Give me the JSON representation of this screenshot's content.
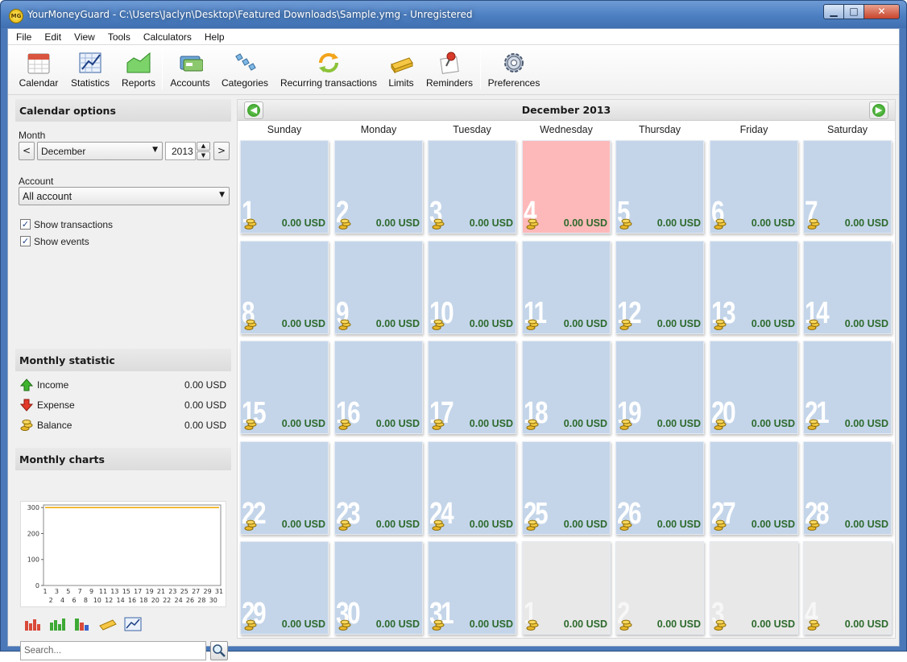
{
  "window": {
    "title": "YourMoneyGuard - C:\\Users\\Jaclyn\\Desktop\\Featured Downloads\\Sample.ymg - Unregistered",
    "app_icon_text": "MG"
  },
  "menu": [
    "File",
    "Edit",
    "View",
    "Tools",
    "Calculators",
    "Help"
  ],
  "toolbar": [
    {
      "label": "Calendar",
      "icon": "calendar-icon"
    },
    {
      "label": "Statistics",
      "icon": "statistics-icon"
    },
    {
      "label": "Reports",
      "icon": "reports-icon"
    },
    {
      "label": "Accounts",
      "icon": "accounts-icon"
    },
    {
      "label": "Categories",
      "icon": "categories-icon"
    },
    {
      "label": "Recurring transactions",
      "icon": "recurring-icon"
    },
    {
      "label": "Limits",
      "icon": "limits-icon"
    },
    {
      "label": "Reminders",
      "icon": "reminders-icon"
    },
    {
      "label": "Preferences",
      "icon": "gear-icon"
    }
  ],
  "calendar_options": {
    "title": "Calendar options",
    "month_label": "Month",
    "month_value": "December",
    "year_value": "2013",
    "prev_btn": "<",
    "next_btn": ">",
    "account_label": "Account",
    "account_value": "All account",
    "show_transactions": "Show transactions",
    "show_events": "Show events"
  },
  "monthly_statistic": {
    "title": "Monthly statistic",
    "rows": [
      {
        "label": "Income",
        "value": "0.00 USD"
      },
      {
        "label": "Expense",
        "value": "0.00 USD"
      },
      {
        "label": "Balance",
        "value": "0.00 USD"
      }
    ]
  },
  "monthly_charts": {
    "title": "Monthly charts"
  },
  "chart_data": {
    "type": "line",
    "title": "",
    "xlabel": "",
    "ylabel": "",
    "x": [
      1,
      2,
      3,
      4,
      5,
      6,
      7,
      8,
      9,
      10,
      11,
      12,
      13,
      14,
      15,
      16,
      17,
      18,
      19,
      20,
      21,
      22,
      23,
      24,
      25,
      26,
      27,
      28,
      29,
      30,
      31
    ],
    "series": [
      {
        "values": [
          300,
          300,
          300,
          300,
          300,
          300,
          300,
          300,
          300,
          300,
          300,
          300,
          300,
          300,
          300,
          300,
          300,
          300,
          300,
          300,
          300,
          300,
          300,
          300,
          300,
          300,
          300,
          300,
          300,
          300,
          300
        ]
      }
    ],
    "yticks": [
      "300",
      "200",
      "100",
      "0"
    ],
    "xticks_top": [
      "1",
      "3",
      "5",
      "7",
      "9",
      "11",
      "13",
      "15",
      "17",
      "19",
      "21",
      "23",
      "25",
      "27",
      "29",
      "31"
    ],
    "xticks_bottom": [
      "2",
      "4",
      "6",
      "8",
      "10",
      "12",
      "14",
      "16",
      "18",
      "20",
      "22",
      "24",
      "26",
      "28",
      "30"
    ],
    "ylim": [
      0,
      310
    ],
    "line_color": "#f0a800"
  },
  "search": {
    "placeholder": "Search..."
  },
  "calendar": {
    "title": "December 2013",
    "weekdays": [
      "Sunday",
      "Monday",
      "Tuesday",
      "Wednesday",
      "Thursday",
      "Friday",
      "Saturday"
    ],
    "amount": "0.00 USD",
    "days": [
      [
        "1",
        "2",
        "3",
        "4",
        "5",
        "6",
        "7"
      ],
      [
        "8",
        "9",
        "10",
        "11",
        "12",
        "13",
        "14"
      ],
      [
        "15",
        "16",
        "17",
        "18",
        "19",
        "20",
        "21"
      ],
      [
        "22",
        "23",
        "24",
        "25",
        "26",
        "27",
        "28"
      ],
      [
        "29",
        "30",
        "31",
        "1",
        "2",
        "3",
        "4"
      ]
    ],
    "today": "4",
    "colors": {
      "day": "#c4d5e9",
      "today": "#fdb9b9",
      "other": "#e8e8e8",
      "amount": "#2d6a2d"
    }
  }
}
